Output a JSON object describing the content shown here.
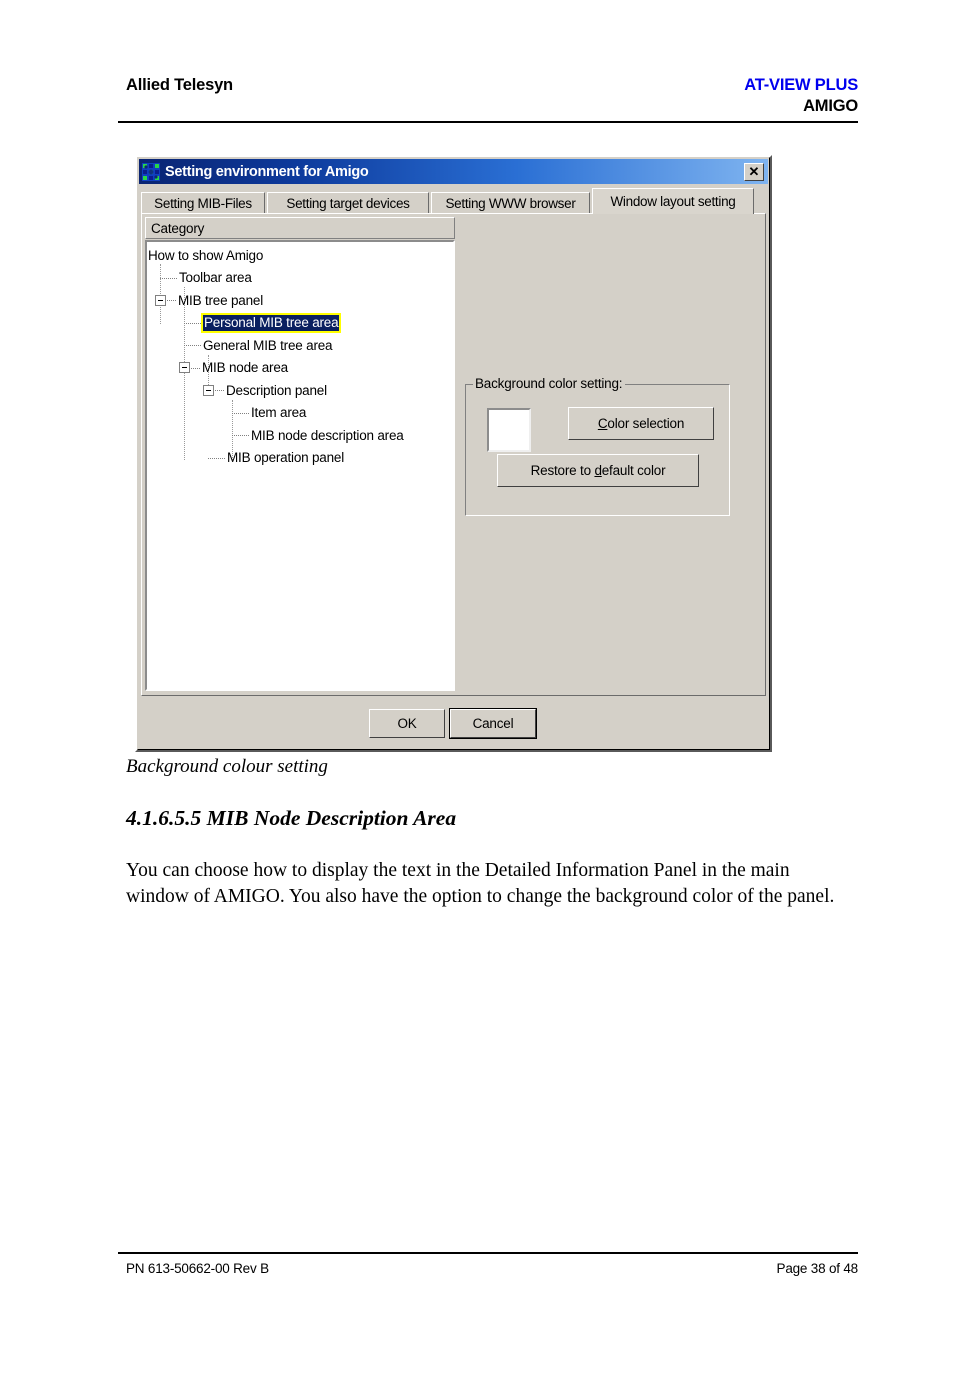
{
  "page_header": {
    "company": "Allied Telesyn",
    "product": "AT-VIEW PLUS",
    "module": "AMIGO",
    "product_color": "#0000ee"
  },
  "dialog": {
    "title": "Setting environment for Amigo",
    "title_icon": "network-nodes-icon",
    "close_label": "✕",
    "titlebar_gradient_from": "#0a2472",
    "titlebar_gradient_to": "#7fb4f0",
    "face_color": "#d4d0c8",
    "tabs": [
      {
        "label": "Setting MIB-Files",
        "active": false
      },
      {
        "label": "Setting target devices",
        "active": false
      },
      {
        "label": "Setting WWW browser",
        "active": false
      },
      {
        "label": "Window layout setting",
        "active": true
      }
    ],
    "category_header": "Category",
    "tree": {
      "selection_bg": "#0a2060",
      "selection_focus": "#ffff00",
      "items": [
        {
          "label": "How to show Amigo",
          "depth": 0,
          "toggle": "none",
          "selected": false
        },
        {
          "label": "Toolbar area",
          "depth": 1,
          "toggle": "none",
          "selected": false
        },
        {
          "label": "MIB tree panel",
          "depth": 1,
          "toggle": "expanded",
          "selected": false
        },
        {
          "label": "Personal MIB tree area",
          "depth": 2,
          "toggle": "none",
          "selected": true
        },
        {
          "label": "General MIB tree area",
          "depth": 2,
          "toggle": "none",
          "selected": false
        },
        {
          "label": "MIB node area",
          "depth": 2,
          "toggle": "expanded",
          "selected": false
        },
        {
          "label": "Description panel",
          "depth": 3,
          "toggle": "expanded",
          "selected": false
        },
        {
          "label": "Item area",
          "depth": 4,
          "toggle": "none",
          "selected": false
        },
        {
          "label": "MIB node description area",
          "depth": 4,
          "toggle": "none",
          "selected": false
        },
        {
          "label": "MIB operation panel",
          "depth": 3,
          "toggle": "none",
          "selected": false
        }
      ]
    },
    "groupbox": {
      "legend": "Background color setting:",
      "swatch_color": "#ffffff",
      "color_selection": {
        "pre": "",
        "accel": "C",
        "post": "olor selection"
      },
      "restore_default": {
        "pre": "Restore to ",
        "accel": "d",
        "post": "efault color"
      }
    },
    "buttons": {
      "ok": "OK",
      "cancel": "Cancel"
    }
  },
  "document": {
    "figure_caption": "Background colour setting",
    "section_heading": "4.1.6.5.5 MIB Node Description Area",
    "paragraph": "You can choose how to display the text in the Detailed Information Panel in the main window of AMIGO. You also have the option to change the background color of the panel."
  },
  "page_footer": {
    "part_number": "PN 613-50662-00 Rev B",
    "page_number": "Page 38 of 48"
  }
}
